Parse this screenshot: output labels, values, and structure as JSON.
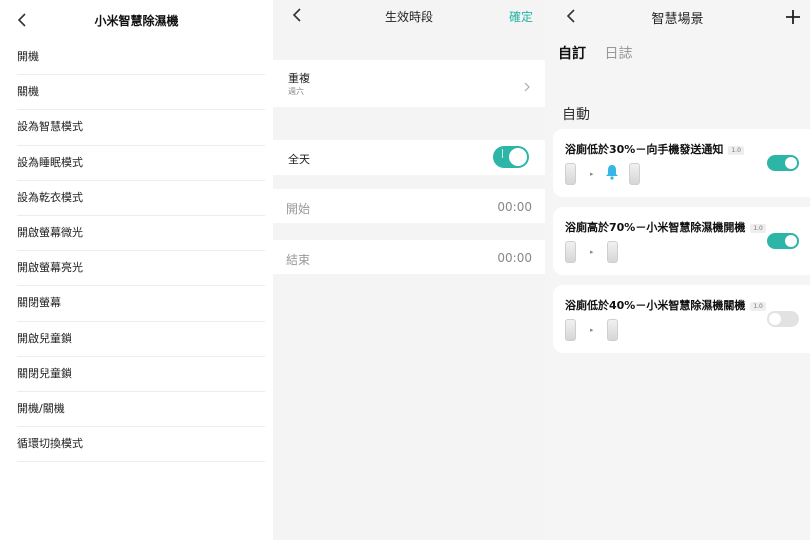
{
  "panel1": {
    "title": "小米智慧除濕機",
    "back_icon": "chevron-left-icon",
    "items": [
      "開機",
      "關機",
      "設為智慧模式",
      "設為睡眠模式",
      "設為乾衣模式",
      "開啟螢幕微光",
      "開啟螢幕亮光",
      "關閉螢幕",
      "開啟兒童鎖",
      "關閉兒童鎖",
      "開機/關機",
      "循環切換模式"
    ]
  },
  "panel2": {
    "title": "生效時段",
    "confirm": "確定",
    "repeat": {
      "label": "重複",
      "value": "週六"
    },
    "all_day": {
      "label": "全天",
      "on": true
    },
    "start": {
      "label": "開始",
      "value": "00:00"
    },
    "end": {
      "label": "結束",
      "value": "00:00"
    }
  },
  "panel3": {
    "title": "智慧場景",
    "add_icon": "plus-icon",
    "tabs": [
      "自訂",
      "日誌"
    ],
    "section": "自動",
    "scenes": [
      {
        "title": "浴廁低於30%－向手機發送通知",
        "version": "1.0",
        "on": true,
        "action": "bell"
      },
      {
        "title": "浴廁高於70%－小米智慧除濕機開機",
        "version": "1.0",
        "on": true,
        "action": "device"
      },
      {
        "title": "浴廁低於40%－小米智慧除濕機關機",
        "version": "1.0",
        "on": false,
        "action": "device"
      }
    ]
  },
  "colors": {
    "accent": "#2db5a8",
    "confirm": "#22b3a4",
    "bell": "#36b6e8"
  }
}
